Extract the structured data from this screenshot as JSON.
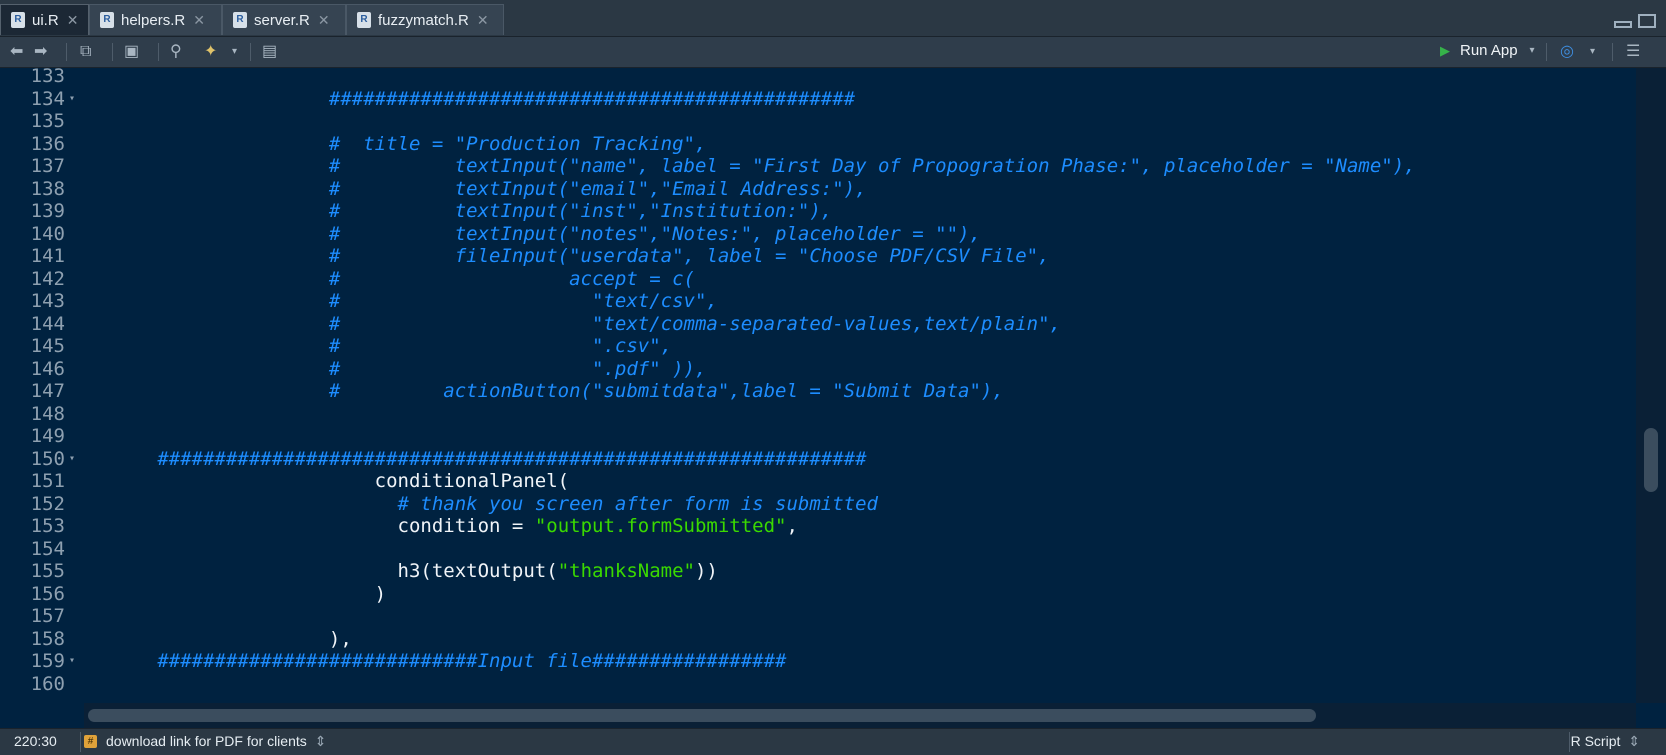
{
  "tabs": [
    {
      "label": "ui.R",
      "icon": "r-file-icon",
      "active": true
    },
    {
      "label": "helpers.R",
      "icon": "r-file-icon",
      "active": false
    },
    {
      "label": "server.R",
      "icon": "r-file-icon",
      "active": false
    },
    {
      "label": "fuzzymatch.R",
      "icon": "r-file-icon",
      "active": false
    }
  ],
  "toolbar": {
    "run_label": "Run App",
    "icons": [
      "back-arrow-icon",
      "forward-arrow-icon",
      "show-in-window-icon",
      "save-icon",
      "search-icon",
      "magic-wand-icon",
      "compile-report-icon",
      "publish-icon",
      "outline-icon"
    ]
  },
  "editor": {
    "lines": [
      {
        "n": "133",
        "fold": false,
        "segs": []
      },
      {
        "n": "134",
        "fold": true,
        "segs": [
          {
            "t": "                  ##############################################",
            "k": "c"
          }
        ]
      },
      {
        "n": "135",
        "fold": false,
        "segs": []
      },
      {
        "n": "136",
        "fold": false,
        "segs": [
          {
            "t": "                  #  title = \"Production Tracking\",",
            "k": "c"
          }
        ]
      },
      {
        "n": "137",
        "fold": false,
        "segs": [
          {
            "t": "                  #          textInput(\"name\", label = \"First Day of Propogration Phase:\", placeholder = \"Name\"),",
            "k": "c"
          }
        ]
      },
      {
        "n": "138",
        "fold": false,
        "segs": [
          {
            "t": "                  #          textInput(\"email\",\"Email Address:\"),",
            "k": "c"
          }
        ]
      },
      {
        "n": "139",
        "fold": false,
        "segs": [
          {
            "t": "                  #          textInput(\"inst\",\"Institution:\"),",
            "k": "c"
          }
        ]
      },
      {
        "n": "140",
        "fold": false,
        "segs": [
          {
            "t": "                  #          textInput(\"notes\",\"Notes:\", placeholder = \"\"),",
            "k": "c"
          }
        ]
      },
      {
        "n": "141",
        "fold": false,
        "segs": [
          {
            "t": "                  #          fileInput(\"userdata\", label = \"Choose PDF/CSV File\",",
            "k": "c"
          }
        ]
      },
      {
        "n": "142",
        "fold": false,
        "segs": [
          {
            "t": "                  #                    accept = c(",
            "k": "c"
          }
        ]
      },
      {
        "n": "143",
        "fold": false,
        "segs": [
          {
            "t": "                  #                      \"text/csv\",",
            "k": "c"
          }
        ]
      },
      {
        "n": "144",
        "fold": false,
        "segs": [
          {
            "t": "                  #                      \"text/comma-separated-values,text/plain\",",
            "k": "c"
          }
        ]
      },
      {
        "n": "145",
        "fold": false,
        "segs": [
          {
            "t": "                  #                      \".csv\",",
            "k": "c"
          }
        ]
      },
      {
        "n": "146",
        "fold": false,
        "segs": [
          {
            "t": "                  #                      \".pdf\" )),",
            "k": "c"
          }
        ]
      },
      {
        "n": "147",
        "fold": false,
        "segs": [
          {
            "t": "                  #         actionButton(\"submitdata\",label = \"Submit Data\"),",
            "k": "c"
          }
        ]
      },
      {
        "n": "148",
        "fold": false,
        "segs": []
      },
      {
        "n": "149",
        "fold": false,
        "segs": []
      },
      {
        "n": "150",
        "fold": true,
        "segs": [
          {
            "t": "   ##############################################################",
            "k": "c"
          }
        ]
      },
      {
        "n": "151",
        "fold": false,
        "segs": [
          {
            "t": "                      conditionalPanel(",
            "k": "p"
          }
        ]
      },
      {
        "n": "152",
        "fold": false,
        "segs": [
          {
            "t": "                        # thank you screen after form is submitted",
            "k": "c"
          }
        ]
      },
      {
        "n": "153",
        "fold": false,
        "segs": [
          {
            "t": "                        condition = ",
            "k": "p"
          },
          {
            "t": "\"output.formSubmitted\"",
            "k": "s"
          },
          {
            "t": ",",
            "k": "p"
          }
        ]
      },
      {
        "n": "154",
        "fold": false,
        "segs": []
      },
      {
        "n": "155",
        "fold": false,
        "segs": [
          {
            "t": "                        h3(textOutput(",
            "k": "p"
          },
          {
            "t": "\"thanksName\"",
            "k": "s"
          },
          {
            "t": "))",
            "k": "p"
          }
        ]
      },
      {
        "n": "156",
        "fold": false,
        "segs": [
          {
            "t": "                      )",
            "k": "p"
          }
        ]
      },
      {
        "n": "157",
        "fold": false,
        "segs": []
      },
      {
        "n": "158",
        "fold": false,
        "segs": [
          {
            "t": "                  ),",
            "k": "p"
          }
        ]
      },
      {
        "n": "159",
        "fold": true,
        "segs": [
          {
            "t": "   ############################Input file#################",
            "k": "c"
          }
        ]
      },
      {
        "n": "160",
        "fold": false,
        "segs": []
      }
    ]
  },
  "status": {
    "position": "220:30",
    "section": "download link for PDF for clients",
    "section_arrow": "⇕",
    "language": "R Script",
    "language_arrow": "⇕"
  }
}
